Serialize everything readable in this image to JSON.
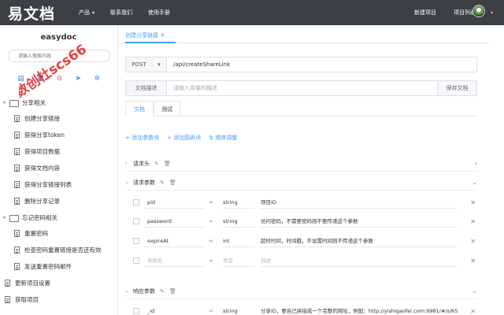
{
  "topbar": {
    "logo": "易文档",
    "nav": [
      "产品",
      "联系我们",
      "使用手册"
    ],
    "right": [
      "新建项目",
      "项目列表"
    ]
  },
  "sidebar": {
    "project_name": "easydoc",
    "search_placeholder": "请输入搜索内容",
    "watermark": "数创杜scs66",
    "tree": [
      {
        "type": "folder",
        "label": "分享相关"
      },
      {
        "type": "leaf",
        "label": "创建分享链接"
      },
      {
        "type": "leaf",
        "label": "获得分享token"
      },
      {
        "type": "leaf",
        "label": "获得项目数据"
      },
      {
        "type": "leaf",
        "label": "获得文档内容"
      },
      {
        "type": "leaf",
        "label": "获得分享链接列表"
      },
      {
        "type": "leaf",
        "label": "删除分享记录"
      },
      {
        "type": "folder",
        "label": "忘记密码相关"
      },
      {
        "type": "leaf",
        "label": "重置密码"
      },
      {
        "type": "leaf",
        "label": "检查密码重置链接是否还有效"
      },
      {
        "type": "leaf",
        "label": "发送重置密码邮件"
      },
      {
        "type": "root",
        "label": "更新项目设置"
      },
      {
        "type": "root",
        "label": "获取项目"
      }
    ]
  },
  "main": {
    "tab_label": "创建分享链接",
    "method": "POST",
    "url": "/api/createShareLink",
    "desc_label": "文档描述",
    "desc_placeholder": "请输入简单的描述",
    "save_label": "保存文档",
    "sub_tabs": [
      "文档",
      "测试"
    ],
    "actions": [
      "+ 添加参数块",
      "+ 添加图表块",
      "⇅ 顺序调整"
    ],
    "sections": {
      "headers": "请求头",
      "params": "请求参数",
      "response": "响应参数"
    },
    "params": [
      {
        "name": "pid",
        "type": "string",
        "desc": "项目ID",
        "placeholder": false
      },
      {
        "name": "password",
        "type": "string",
        "desc": "访问密码，不需要密码则不要传递这个参数",
        "placeholder": false
      },
      {
        "name": "expireAt",
        "type": "int",
        "desc": "超时时间，时间戳，不设置时间则不传递这个参数",
        "placeholder": false
      },
      {
        "name": "参数名",
        "type": "类型",
        "desc": "描述",
        "placeholder": true
      }
    ],
    "response": [
      {
        "name": "_id",
        "type": "string",
        "desc": "分享ID，要自己拼接成一个完整的网址，例如：http://yishigaofei.com:9981/#/s/65"
      }
    ]
  },
  "colors": {
    "accent": "#409eff",
    "topbar": "#3c3f44"
  }
}
